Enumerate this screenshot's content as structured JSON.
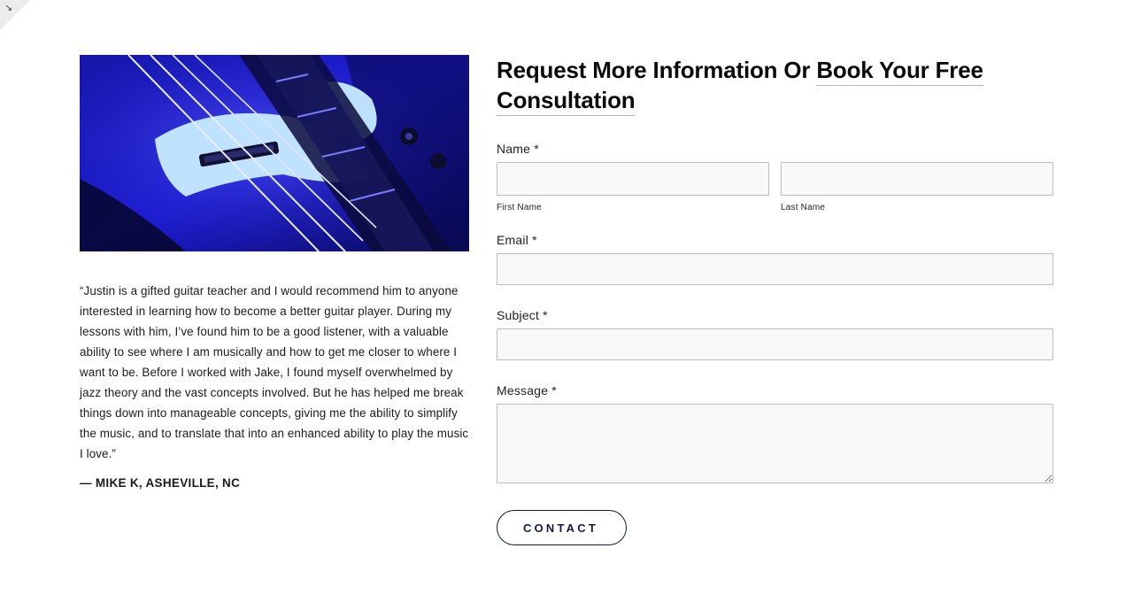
{
  "corner": {
    "icon": "resize-arrow-icon",
    "glyph": "↘"
  },
  "testimonial": {
    "image_alt": "Close-up of bass guitar strings and pickups in blue light",
    "quote": "“Justin is a gifted guitar teacher and I would recommend him to anyone interested in learning how to become a better guitar player. During my lessons with him, I’ve found him to be a good listener, with a valuable ability to see where I am musically and how to get me closer to where I want to be. Before I worked with Jake, I found myself overwhelmed by jazz theory and the vast concepts involved. But he has helped me break things down into manageable concepts, giving me the ability to simplify the music, and to translate that into an enhanced ability to play the music I love.”",
    "attribution": "— MIKE K, ASHEVILLE, NC"
  },
  "form": {
    "heading_prefix": "Request More Information Or ",
    "heading_link": "Book Your Free Consultation",
    "name_label": "Name *",
    "first_name_label": "First Name",
    "last_name_label": "Last Name",
    "first_name_value": "",
    "last_name_value": "",
    "email_label": "Email *",
    "email_value": "",
    "subject_label": "Subject *",
    "subject_value": "",
    "message_label": "Message *",
    "message_value": "",
    "submit_label": "CONTACT"
  },
  "colors": {
    "button_navy": "#121a3f",
    "field_bg": "#f8f8f8",
    "field_border": "#bdbdbd",
    "image_blue": "#2a2ad8"
  }
}
